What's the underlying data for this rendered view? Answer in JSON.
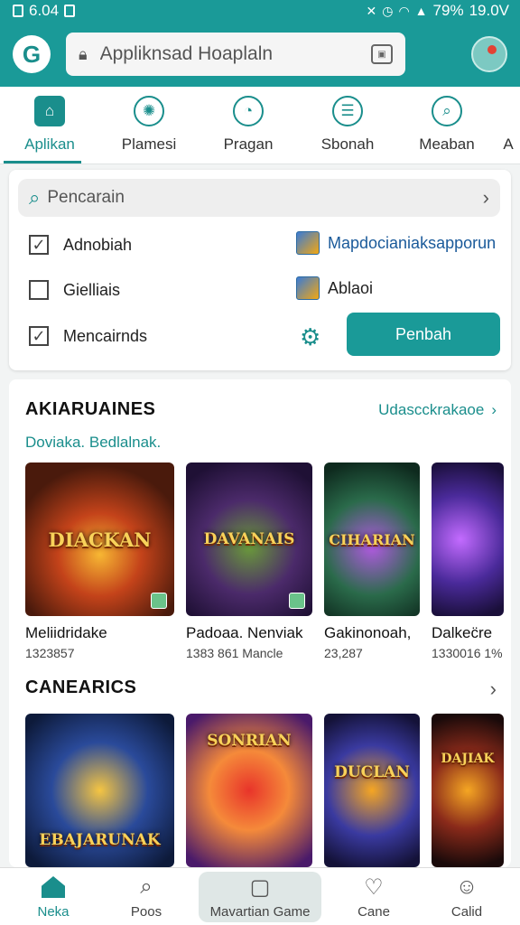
{
  "status": {
    "time": "6.04",
    "battery": "79%",
    "clock": "19.0V"
  },
  "appbar": {
    "url": "Appliknsad Hoaplaln",
    "logo_letter": "G"
  },
  "categories": [
    {
      "label": "Aplikan",
      "icon": "home-icon"
    },
    {
      "label": "Plamesi",
      "icon": "brain-icon"
    },
    {
      "label": "Pragan",
      "icon": "chat-icon"
    },
    {
      "label": "Sbonah",
      "icon": "book-icon"
    },
    {
      "label": "Meaban",
      "icon": "search-icon"
    },
    {
      "label": "A"
    }
  ],
  "filters": {
    "search_placeholder": "Pencarain",
    "checks": [
      {
        "label": "Adnobiah",
        "checked": true
      },
      {
        "label": "Gielliais",
        "checked": false
      },
      {
        "label": "Mencairnds",
        "checked": true
      }
    ],
    "options": [
      "Mapdocianiaksapporun",
      "Ablaoi"
    ],
    "apply_label": "Penbah"
  },
  "section1": {
    "title": "AKIARUAINES",
    "link": "Udascckrakaoe",
    "subtitle": "Doviaka. Bedlalnak.",
    "cards": [
      {
        "art_text": "DIACKAN",
        "name": "Meliidridake",
        "meta": "1323857"
      },
      {
        "art_text": "DAVANAIS",
        "name": "Padoaa. Nenviak",
        "meta": "1383 861 Mancle"
      },
      {
        "art_text": "CIHARIAN",
        "name": "Gakinonoah,",
        "meta": "23,287"
      },
      {
        "art_text": "",
        "name": "Dalkec̈re",
        "meta": "1330016 1%"
      }
    ]
  },
  "section2": {
    "title": "CANEARICS",
    "cards": [
      {
        "art_text": "EBAJARUNAK"
      },
      {
        "art_text": "SONRIAN"
      },
      {
        "art_text": "DUCLAN"
      },
      {
        "art_text": "DAJIAK"
      }
    ]
  },
  "bottomnav": [
    {
      "label": "Neka",
      "icon": "home-icon"
    },
    {
      "label": "Poos",
      "icon": "search-icon"
    },
    {
      "label": "Mavartian Game",
      "icon": "bag-icon"
    },
    {
      "label": "Cane",
      "icon": "heart-icon"
    },
    {
      "label": "Calid",
      "icon": "person-icon"
    }
  ],
  "colors": {
    "accent": "#1a9a98",
    "accent_dark": "#1a8e8c"
  }
}
